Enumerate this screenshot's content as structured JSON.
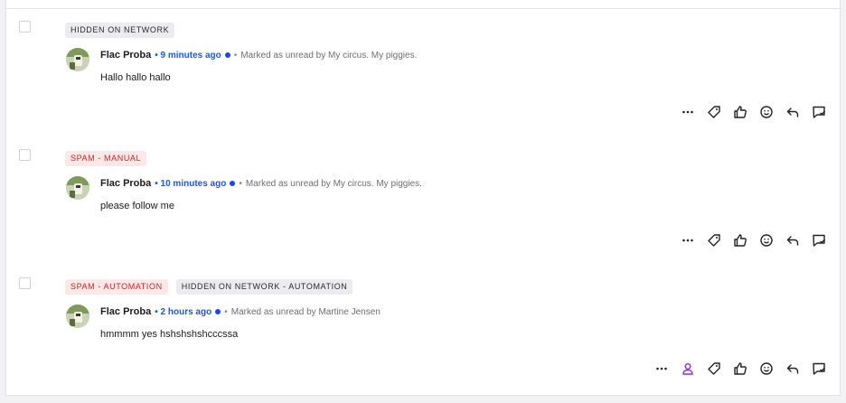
{
  "items": [
    {
      "badges": [
        {
          "label": "HIDDEN ON NETWORK",
          "tone": "gray"
        }
      ],
      "author": "Flac Proba",
      "time": "• 9 minutes ago",
      "separator": "•",
      "status": "Marked as unread by My circus. My piggies.",
      "text": "Hallo hallo hallo",
      "actions": [
        "more-icon",
        "tag-icon",
        "thumbs-up-icon",
        "smile-icon",
        "reply-icon",
        "comment-check-icon"
      ]
    },
    {
      "badges": [
        {
          "label": "SPAM - MANUAL",
          "tone": "red"
        }
      ],
      "author": "Flac Proba",
      "time": "• 10 minutes ago",
      "separator": "•",
      "status": "Marked as unread by My circus. My piggies.",
      "text": "please follow me",
      "actions": [
        "more-icon",
        "tag-icon",
        "thumbs-up-icon",
        "smile-icon",
        "reply-icon",
        "comment-check-icon"
      ]
    },
    {
      "badges": [
        {
          "label": "SPAM - AUTOMATION",
          "tone": "red"
        },
        {
          "label": "HIDDEN ON NETWORK - AUTOMATION",
          "tone": "gray"
        }
      ],
      "author": "Flac Proba",
      "time": "• 2 hours ago",
      "separator": "•",
      "status": "Marked as unread by Martine Jensen",
      "text": "hmmmm yes hshshshshcccssa",
      "actions": [
        "more-icon",
        "assign-user-icon",
        "tag-icon",
        "thumbs-up-icon",
        "smile-icon",
        "reply-icon",
        "comment-check-icon"
      ]
    }
  ],
  "colors": {
    "accent_blue": "#1f57d6",
    "spam_red": "#c0282d",
    "assign_purple": "#9b2bd1"
  }
}
